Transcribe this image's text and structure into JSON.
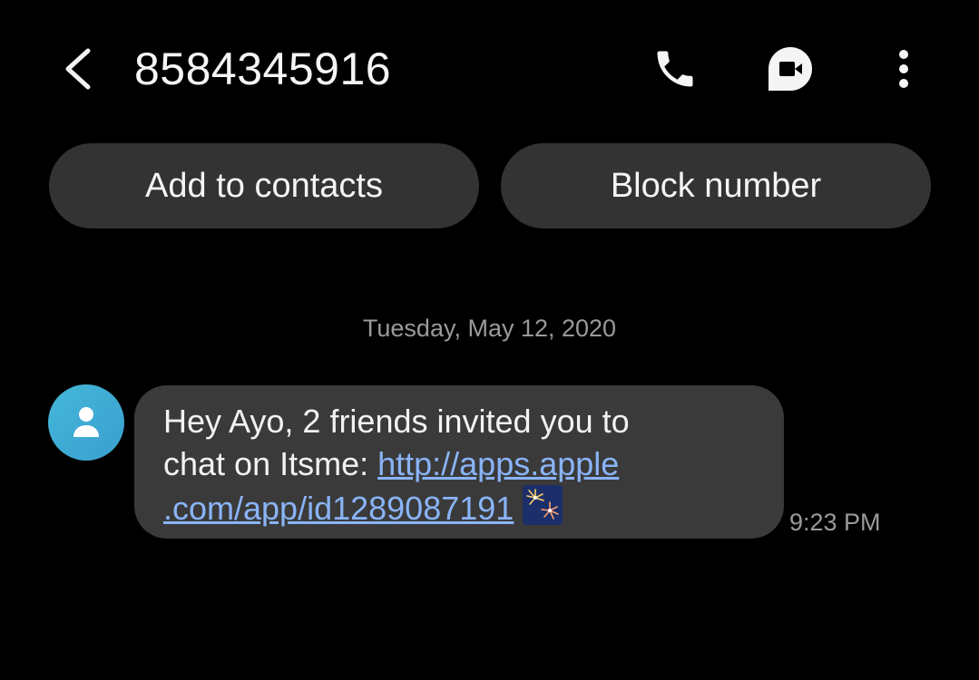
{
  "header": {
    "title": "8584345916",
    "icons": {
      "back": "back-arrow-icon",
      "call": "phone-icon",
      "video": "video-call-icon",
      "more": "more-options-icon"
    }
  },
  "actions": {
    "add_contact_label": "Add to contacts",
    "block_label": "Block number"
  },
  "conversation": {
    "date": "Tuesday, May 12, 2020",
    "messages": [
      {
        "sender_avatar": "person-icon",
        "text_line1": "Hey Ayo, 2 friends invited you to",
        "text_line2_prefix": "chat on Itsme: ",
        "link_part1": "http://apps.apple",
        "link_part2": ".com/app/id1289087191",
        "emoji": "fireworks-emoji",
        "time": "9:23 PM"
      }
    ]
  },
  "colors": {
    "background": "#000000",
    "button_bg": "#333333",
    "bubble_bg": "#3a3a3a",
    "link": "#8ab4f8",
    "muted_text": "#9a9a9a",
    "avatar": "#44b7d8"
  }
}
